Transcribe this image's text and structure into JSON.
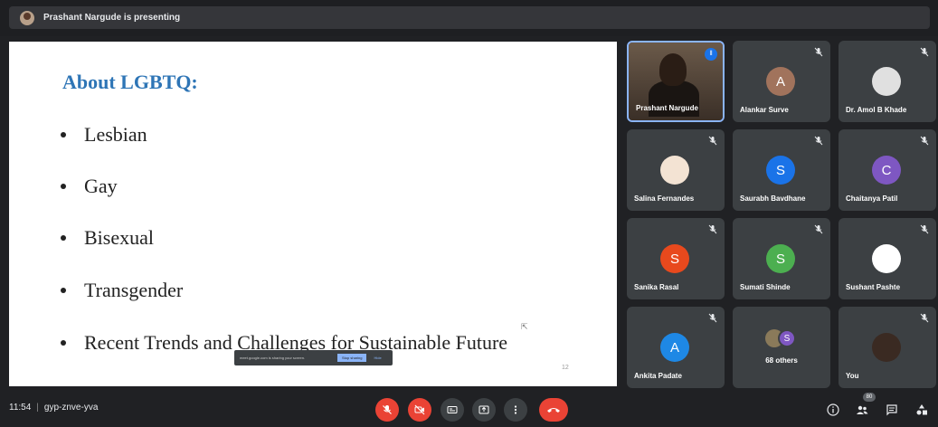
{
  "presenter_banner": {
    "text": "Prashant Nargude is presenting"
  },
  "slide": {
    "title": "About LGBTQ:",
    "bullets": [
      "Lesbian",
      "Gay",
      "Bisexual",
      "Transgender",
      "Recent Trends and Challenges for Sustainable Future"
    ],
    "page_number": "12",
    "share_bar": {
      "text": "meet.google.com is sharing your screen.",
      "stop_label": "Stop sharing",
      "hide_label": "Hide"
    }
  },
  "participants": [
    {
      "name": "Prashant Nargude",
      "type": "video",
      "speaking": true
    },
    {
      "name": "Alankar Surve",
      "initial": "A",
      "color": "#a1735c",
      "muted": true
    },
    {
      "name": "Dr. Amol B Khade",
      "type": "photo",
      "color": "#e0e0e0",
      "muted": true
    },
    {
      "name": "Salina Fernandes",
      "type": "photo",
      "color": "#f3e3d3",
      "muted": true
    },
    {
      "name": "Saurabh Bavdhane",
      "initial": "S",
      "color": "#1a73e8",
      "muted": true
    },
    {
      "name": "Chaitanya Patil",
      "initial": "C",
      "color": "#7e57c2",
      "muted": true
    },
    {
      "name": "Sanika Rasal",
      "initial": "S",
      "color": "#e8491d",
      "muted": true
    },
    {
      "name": "Sumati Shinde",
      "initial": "S",
      "color": "#4caf50",
      "muted": true
    },
    {
      "name": "Sushant Pashte",
      "type": "photo",
      "color": "#ffffff",
      "muted": true
    },
    {
      "name": "Ankita Padate",
      "initial": "A",
      "color": "#1e88e5",
      "muted": true
    },
    {
      "name": "68 others",
      "type": "others"
    },
    {
      "name": "You",
      "type": "photo",
      "color": "#3a2a22",
      "muted": true
    }
  ],
  "bottom_bar": {
    "time": "11:54",
    "meeting_code": "gyp-znve-yva",
    "participant_count": "80"
  }
}
